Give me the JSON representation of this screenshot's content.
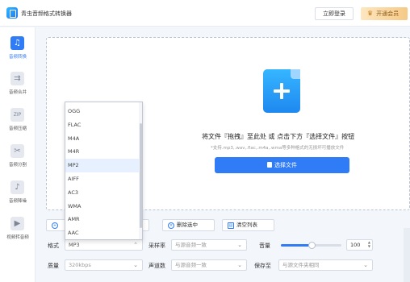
{
  "app": {
    "title": "青虫音频格式转换器",
    "login_label": "立即登录",
    "vip_label": "开通会员"
  },
  "sidebar": {
    "items": [
      {
        "label": "音频转换",
        "icon": "music-note-icon",
        "active": true
      },
      {
        "label": "音频合并",
        "icon": "merge-icon"
      },
      {
        "label": "音频压缩",
        "icon": "zip-icon"
      },
      {
        "label": "音频分割",
        "icon": "scissors-icon"
      },
      {
        "label": "音频降噪",
        "icon": "noise-reduction-icon"
      },
      {
        "label": "视频转音频",
        "icon": "video-to-audio-icon"
      }
    ]
  },
  "dropzone": {
    "hint": "将文件『拖拽』至此处 或 点击下方『选择文件』按钮",
    "sub_hint": "*支持.mp3,.wav,.flac,.m4a,.wma等多种格式的无损坏可播放文件",
    "select_label": "选择文件"
  },
  "actions": {
    "add_label": "",
    "folder_label": "夹",
    "delete_label": "删除选中",
    "clear_label": "清空列表"
  },
  "settings": {
    "format_label": "格式",
    "format_value": "MP3",
    "sample_rate_label": "采样率",
    "sample_rate_value": "与源音频一致",
    "volume_label": "音量",
    "volume_value": "100",
    "volume_level": 0.5,
    "quality_label": "质量",
    "quality_value": "320kbps",
    "channels_label": "声道数",
    "channels_value": "与源音频一致",
    "save_label": "保存至",
    "save_value": "与源文件夹相同"
  },
  "dropdown": {
    "options": [
      "OGG",
      "FLAC",
      "M4A",
      "M4R",
      "MP2",
      "AIFF",
      "AC3",
      "WMA",
      "AMR",
      "AAC"
    ],
    "highlighted": "MP2"
  },
  "colors": {
    "accent": "#2f7cf6",
    "vip": "#f6c985"
  }
}
